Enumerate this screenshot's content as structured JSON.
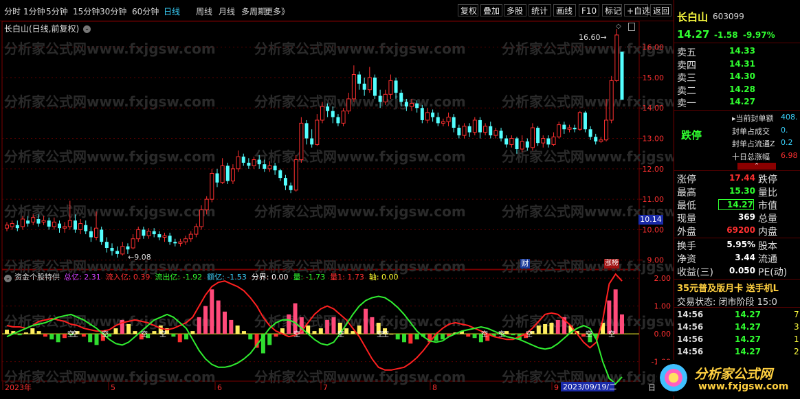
{
  "toolbar": {
    "periods": [
      "分时",
      "1分钟",
      "5分钟",
      "15分钟",
      "30分钟",
      "60分钟",
      "日线",
      "周线",
      "月线",
      "多周期",
      "更多》"
    ],
    "active_period": "日线",
    "buttons": [
      "复权",
      "叠加",
      "多股",
      "统计",
      "画线",
      "F10",
      "标记",
      "+自选",
      "返回"
    ]
  },
  "main_chart": {
    "title": "长白山(日线,前复权)",
    "price_labels": [
      "16.00",
      "15.00",
      "14.00",
      "13.00",
      "12.00",
      "11.00",
      "10.00",
      "9.00"
    ],
    "high_marker": "16.60",
    "low_marker": "9.08",
    "current_price_tag": "10.14",
    "badge_cai": "财",
    "badge_bang": "涨榜",
    "watermark": "分析家公式网www.fxjgsw.com"
  },
  "indicator": {
    "name": "资金个股特供",
    "items": [
      {
        "label": "总亿:",
        "value": "2.31",
        "color": "#d040ff"
      },
      {
        "label": "流入亿:",
        "value": "0.39",
        "color": "#ff3030"
      },
      {
        "label": "流出亿:",
        "value": "-1.92",
        "color": "#30ff30"
      },
      {
        "label": "额亿:",
        "value": "-1.53",
        "color": "#3ad4ff"
      },
      {
        "label": "分界:",
        "value": "0.00",
        "color": "#ffffff"
      },
      {
        "label": "量:",
        "value": "-1.73",
        "color": "#30ff30"
      },
      {
        "label": "量1:",
        "value": "1.73",
        "color": "#ff3030"
      },
      {
        "label": "轴:",
        "value": "0.00",
        "color": "#ffff30"
      }
    ],
    "y_labels": [
      "2.00",
      "1.00",
      "0.00",
      "-1.00"
    ],
    "kong_label": "空"
  },
  "x_axis": {
    "labels": [
      "2023年",
      "5",
      "6",
      "7",
      "8",
      "9"
    ],
    "cursor_date": "2023/09/19/二",
    "right_label": "日"
  },
  "quote": {
    "name": "长白山",
    "code": "603099",
    "price": "14.27",
    "change": "-1.58",
    "pct": "-9.97%",
    "asks": [
      {
        "label": "卖五",
        "price": "14.33"
      },
      {
        "label": "卖四",
        "price": "14.31"
      },
      {
        "label": "卖三",
        "price": "14.30"
      },
      {
        "label": "卖二",
        "price": "14.28"
      },
      {
        "label": "卖一",
        "price": "14.27"
      }
    ],
    "limit_status": "跌停",
    "seal_rows": [
      {
        "label": "当前封单额",
        "value": "408."
      },
      {
        "label": "封单占成交",
        "value": "0."
      },
      {
        "label": "封单占流通Z",
        "value": "0.2"
      },
      {
        "label": "十日总涨幅",
        "value": "6.98"
      }
    ],
    "stats": [
      {
        "l1": "涨停",
        "v1": "17.44",
        "c1": "#ff3030",
        "l2": "跌停"
      },
      {
        "l1": "最高",
        "v1": "15.30",
        "c1": "#30ff30",
        "l2": "量比"
      },
      {
        "l1": "最低",
        "v1": "14.27",
        "c1": "#30ff30",
        "l2": "市值"
      },
      {
        "l1": "现量",
        "v1": "369",
        "c1": "#ffffff",
        "l2": "总量"
      },
      {
        "l1": "外盘",
        "v1": "69200",
        "c1": "#ff3030",
        "l2": "内盘"
      }
    ],
    "stats2": [
      {
        "l1": "换手",
        "v1": "5.95%",
        "l2": "股本"
      },
      {
        "l1": "净资",
        "v1": "3.44",
        "l2": "流通"
      },
      {
        "l1": "收益(三)",
        "v1": "0.050",
        "l2": "PE(动)"
      }
    ],
    "promo": "35元普及版月卡 送手机L",
    "trade_status": "交易状态: 闭市阶段 15:0",
    "ticks": [
      {
        "time": "14:56",
        "price": "14.27",
        "vol": "7"
      },
      {
        "time": "14:56",
        "price": "14.27",
        "vol": "3"
      },
      {
        "time": "14:56",
        "price": "14.27",
        "vol": "1"
      },
      {
        "time": "14:56",
        "price": "14.27",
        "vol": "2"
      }
    ],
    "logo_text": "分析家公式网",
    "logo_url": "www.fxjgsw.com"
  },
  "chart_data": [
    {
      "type": "candlestick",
      "title": "长白山(日线,前复权)",
      "ylim": [
        8.7,
        16.85
      ],
      "candles": [
        [
          10.05,
          10.15,
          9.95,
          10.25
        ],
        [
          10.1,
          10.2,
          10.0,
          10.3
        ],
        [
          10.15,
          10.05,
          9.95,
          10.3
        ],
        [
          10.1,
          10.35,
          10.0,
          10.45
        ],
        [
          10.3,
          10.2,
          10.1,
          10.45
        ],
        [
          10.25,
          10.4,
          10.15,
          10.5
        ],
        [
          10.35,
          10.2,
          10.1,
          10.5
        ],
        [
          10.25,
          10.3,
          10.15,
          10.45
        ],
        [
          10.3,
          10.1,
          10.0,
          10.4
        ],
        [
          10.1,
          10.25,
          10.0,
          10.4
        ],
        [
          10.2,
          10.05,
          9.9,
          10.3
        ],
        [
          10.05,
          10.1,
          9.9,
          10.25
        ],
        [
          10.1,
          10.3,
          10.0,
          10.95
        ],
        [
          10.3,
          10.0,
          9.9,
          10.5
        ],
        [
          10.0,
          10.2,
          9.85,
          10.35
        ],
        [
          10.15,
          9.95,
          9.85,
          10.3
        ],
        [
          9.95,
          9.75,
          9.6,
          10.1
        ],
        [
          9.75,
          10.05,
          9.65,
          10.6
        ],
        [
          10.0,
          9.6,
          9.5,
          10.1
        ],
        [
          9.6,
          9.4,
          9.25,
          9.75
        ],
        [
          9.4,
          9.3,
          9.15,
          9.55
        ],
        [
          9.3,
          9.2,
          9.08,
          9.45
        ],
        [
          9.2,
          9.45,
          9.15,
          9.6
        ],
        [
          9.45,
          9.35,
          9.2,
          9.55
        ],
        [
          9.4,
          9.7,
          9.35,
          9.85
        ],
        [
          9.7,
          10.0,
          9.6,
          10.1
        ],
        [
          10.0,
          9.8,
          9.7,
          10.1
        ],
        [
          9.8,
          9.95,
          9.7,
          10.05
        ],
        [
          9.95,
          9.85,
          9.75,
          10.05
        ],
        [
          9.85,
          9.75,
          9.65,
          9.95
        ],
        [
          9.75,
          9.8,
          9.6,
          9.9
        ],
        [
          9.8,
          9.6,
          9.5,
          9.9
        ],
        [
          9.6,
          9.55,
          9.45,
          9.7
        ],
        [
          9.55,
          9.6,
          9.45,
          9.7
        ],
        [
          9.6,
          9.7,
          9.5,
          9.8
        ],
        [
          9.7,
          9.85,
          9.6,
          9.95
        ],
        [
          9.85,
          10.1,
          9.75,
          10.2
        ],
        [
          10.1,
          10.65,
          10.0,
          10.8
        ],
        [
          10.65,
          11.0,
          10.5,
          11.1
        ],
        [
          11.0,
          11.85,
          10.9,
          12.0
        ],
        [
          11.85,
          11.55,
          11.4,
          12.0
        ],
        [
          11.55,
          12.1,
          11.5,
          12.35
        ],
        [
          12.1,
          11.6,
          11.5,
          12.2
        ],
        [
          11.6,
          12.0,
          11.5,
          12.15
        ],
        [
          12.0,
          12.4,
          11.9,
          12.6
        ],
        [
          12.4,
          12.2,
          12.1,
          12.5
        ],
        [
          12.2,
          12.1,
          12.0,
          12.35
        ],
        [
          12.1,
          12.3,
          12.0,
          12.4
        ],
        [
          12.3,
          12.15,
          12.0,
          12.45
        ],
        [
          12.15,
          12.0,
          11.9,
          12.3
        ],
        [
          12.0,
          12.1,
          11.9,
          12.25
        ],
        [
          12.1,
          11.95,
          11.8,
          12.2
        ],
        [
          11.95,
          11.7,
          11.6,
          12.0
        ],
        [
          11.7,
          11.45,
          11.3,
          11.8
        ],
        [
          11.45,
          11.3,
          11.2,
          11.55
        ],
        [
          11.3,
          12.3,
          11.25,
          12.45
        ],
        [
          12.3,
          13.5,
          12.2,
          13.7
        ],
        [
          13.5,
          13.0,
          12.8,
          13.6
        ],
        [
          13.0,
          12.8,
          12.7,
          13.3
        ],
        [
          12.8,
          13.6,
          12.75,
          13.8
        ],
        [
          13.6,
          14.05,
          13.5,
          14.2
        ],
        [
          14.05,
          13.9,
          13.7,
          14.15
        ],
        [
          13.9,
          13.7,
          13.5,
          14.05
        ],
        [
          13.7,
          13.5,
          13.4,
          13.8
        ],
        [
          13.5,
          13.9,
          13.4,
          14.0
        ],
        [
          13.9,
          14.3,
          13.8,
          14.5
        ],
        [
          14.3,
          15.1,
          14.2,
          15.4
        ],
        [
          15.1,
          14.8,
          14.6,
          15.2
        ],
        [
          14.8,
          14.6,
          14.4,
          15.0
        ],
        [
          14.6,
          15.0,
          14.5,
          15.35
        ],
        [
          15.0,
          14.4,
          14.3,
          15.1
        ],
        [
          14.4,
          14.2,
          14.0,
          14.6
        ],
        [
          14.2,
          14.45,
          14.1,
          14.6
        ],
        [
          14.45,
          14.9,
          14.3,
          15.1
        ],
        [
          14.9,
          14.5,
          14.3,
          15.0
        ],
        [
          14.5,
          14.2,
          14.05,
          14.6
        ],
        [
          14.2,
          14.05,
          13.9,
          14.3
        ],
        [
          14.05,
          14.15,
          13.9,
          14.3
        ],
        [
          14.15,
          14.0,
          13.85,
          14.25
        ],
        [
          14.0,
          13.6,
          13.5,
          14.1
        ],
        [
          13.6,
          13.85,
          13.5,
          14.0
        ],
        [
          13.85,
          13.7,
          13.55,
          13.95
        ],
        [
          13.7,
          13.5,
          13.4,
          13.85
        ],
        [
          13.5,
          13.55,
          13.4,
          13.65
        ],
        [
          13.55,
          13.7,
          13.4,
          13.85
        ],
        [
          13.7,
          13.35,
          13.2,
          13.8
        ],
        [
          13.35,
          13.1,
          13.0,
          13.45
        ],
        [
          13.1,
          13.4,
          13.0,
          13.5
        ],
        [
          13.4,
          13.2,
          13.05,
          13.5
        ],
        [
          13.2,
          13.6,
          13.1,
          13.7
        ],
        [
          13.6,
          13.2,
          13.0,
          13.7
        ],
        [
          13.2,
          13.4,
          13.1,
          13.5
        ],
        [
          13.4,
          13.1,
          13.0,
          13.55
        ],
        [
          13.1,
          13.25,
          13.0,
          13.35
        ],
        [
          13.25,
          13.0,
          12.9,
          13.35
        ],
        [
          13.0,
          12.8,
          12.7,
          13.1
        ],
        [
          12.8,
          13.0,
          12.7,
          13.1
        ],
        [
          13.0,
          12.65,
          12.5,
          13.05
        ],
        [
          12.65,
          12.9,
          12.55,
          13.1
        ],
        [
          12.9,
          12.7,
          12.6,
          13.0
        ],
        [
          12.7,
          13.35,
          12.6,
          13.5
        ],
        [
          13.35,
          12.85,
          12.75,
          13.4
        ],
        [
          12.85,
          13.0,
          12.7,
          13.1
        ],
        [
          13.0,
          12.8,
          12.7,
          13.1
        ],
        [
          12.8,
          13.05,
          12.75,
          13.2
        ],
        [
          13.05,
          13.45,
          13.0,
          13.55
        ],
        [
          13.45,
          13.3,
          13.15,
          13.55
        ],
        [
          13.3,
          13.35,
          13.2,
          13.45
        ],
        [
          13.35,
          13.3,
          13.2,
          13.45
        ],
        [
          13.3,
          13.85,
          13.25,
          13.9
        ],
        [
          13.85,
          13.3,
          13.2,
          13.9
        ],
        [
          13.3,
          13.05,
          12.95,
          13.4
        ],
        [
          13.05,
          12.9,
          12.8,
          13.15
        ],
        [
          12.9,
          12.95,
          12.85,
          13.05
        ],
        [
          12.95,
          13.6,
          12.9,
          14.3
        ],
        [
          13.6,
          14.9,
          13.5,
          15.05
        ],
        [
          14.9,
          16.4,
          14.85,
          16.6
        ],
        [
          15.85,
          14.27,
          14.27,
          15.3
        ]
      ]
    },
    {
      "type": "line_bar",
      "ylim": [
        -1.7,
        2.3
      ],
      "red_line": [
        0.3,
        0.25,
        0.25,
        0.2,
        0.3,
        0.45,
        0.5,
        0.55,
        0.5,
        0.45,
        0.35,
        0.3,
        0.2,
        0.15,
        0.1,
        0.1,
        0.15,
        0.3,
        0.4,
        0.45,
        0.5,
        0.45,
        0.4,
        0.3,
        0.2,
        0.15,
        0.2,
        0.3,
        0.4,
        0.6,
        1.0,
        1.4,
        1.7,
        1.85,
        1.9,
        1.8,
        1.7,
        1.55,
        1.3,
        1.0,
        0.6,
        0.3,
        0.1,
        0.0,
        -0.1,
        -0.05,
        0.1,
        0.4,
        0.7,
        0.9,
        1.0,
        0.9,
        0.7,
        0.5,
        0.2,
        -0.1,
        -0.5,
        -0.9,
        -1.2,
        -1.3,
        -1.3,
        -1.25,
        -1.2,
        -1.05,
        -0.85,
        -0.6,
        -0.3,
        0.0,
        0.2,
        0.35,
        0.4,
        0.35,
        0.3,
        0.2,
        0.1,
        0.0,
        -0.1,
        -0.15,
        -0.2,
        -0.2,
        -0.1,
        0.0,
        0.2,
        0.45,
        0.7,
        0.75,
        0.7,
        0.5,
        0.3,
        0.0,
        -0.3,
        -0.5,
        -0.3,
        0.5,
        1.8,
        2.15,
        1.9
      ],
      "green_line": [
        -0.1,
        0.0,
        0.1,
        0.2,
        0.3,
        0.35,
        0.4,
        0.5,
        0.6,
        0.65,
        0.7,
        0.6,
        0.5,
        0.35,
        0.2,
        0.0,
        -0.2,
        -0.35,
        -0.4,
        -0.3,
        -0.1,
        0.1,
        0.3,
        0.5,
        0.6,
        0.7,
        0.6,
        0.4,
        0.2,
        -0.2,
        -0.6,
        -0.9,
        -1.1,
        -1.2,
        -1.2,
        -1.15,
        -1.05,
        -0.9,
        -0.7,
        -0.4,
        -0.1,
        0.2,
        0.4,
        0.5,
        0.5,
        0.4,
        0.2,
        0.0,
        -0.2,
        -0.35,
        -0.4,
        -0.3,
        0.0,
        0.35,
        0.7,
        1.0,
        1.2,
        1.3,
        1.35,
        1.3,
        1.15,
        0.95,
        0.7,
        0.4,
        0.1,
        -0.1,
        -0.25,
        -0.3,
        -0.25,
        -0.1,
        0.0,
        0.1,
        0.15,
        0.2,
        0.25,
        0.2,
        0.1,
        0.0,
        -0.1,
        -0.15,
        -0.2,
        -0.3,
        -0.4,
        -0.5,
        -0.55,
        -0.5,
        -0.35,
        -0.15,
        0.05,
        0.2,
        0.3,
        0.2,
        -0.2,
        -1.0,
        -1.6,
        -1.8,
        -1.55
      ],
      "bars": [
        0.15,
        0.1,
        -0.05,
        0.05,
        0.2,
        0.1,
        -0.1,
        -0.2,
        -0.3,
        -0.15,
        -0.05,
        0.1,
        -0.1,
        -0.3,
        -0.4,
        -0.25,
        -0.1,
        0.2,
        0.5,
        0.35,
        0.1,
        -0.2,
        -0.15,
        0.1,
        0.3,
        0.2,
        -0.1,
        -0.3,
        -0.2,
        0.1,
        0.6,
        1.0,
        1.6,
        1.2,
        0.8,
        0.5,
        0.3,
        0.1,
        -0.2,
        -0.5,
        -0.7,
        -0.4,
        -0.1,
        0.2,
        0.7,
        1.1,
        0.6,
        0.3,
        0.1,
        0.2,
        0.5,
        0.6,
        0.4,
        0.2,
        0.1,
        0.3,
        0.9,
        0.6,
        0.4,
        0.2,
        0.0,
        -0.2,
        -0.3,
        -0.35,
        -0.2,
        -0.1,
        -0.3,
        -0.25,
        -0.2,
        -0.1,
        0.05,
        0.1,
        -0.1,
        -0.15,
        -0.3,
        -0.25,
        -0.1,
        0.05,
        0.1,
        -0.05,
        -0.2,
        -0.15,
        0.1,
        0.3,
        0.35,
        0.4,
        0.5,
        0.6,
        0.3,
        0.1,
        -0.1,
        -0.3,
        -0.15,
        0.4,
        1.2,
        1.6,
        0.7
      ]
    }
  ]
}
